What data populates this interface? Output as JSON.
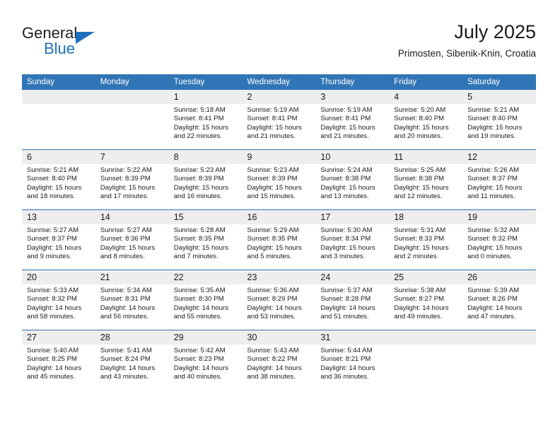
{
  "brand": {
    "name_part1": "General",
    "name_part2": "Blue"
  },
  "header": {
    "month_title": "July 2025",
    "location": "Primosten, Sibenik-Knin, Croatia"
  },
  "colors": {
    "header_blue": "#3075b5",
    "row_rule_blue": "#2e75b6",
    "daynum_bg": "#eeeeee",
    "brand_blue": "#1f6fba"
  },
  "weekday_headers": [
    "Sunday",
    "Monday",
    "Tuesday",
    "Wednesday",
    "Thursday",
    "Friday",
    "Saturday"
  ],
  "weeks": [
    [
      {
        "day": "",
        "sunrise": "",
        "sunset": "",
        "daylight_line1": "",
        "daylight_line2": ""
      },
      {
        "day": "",
        "sunrise": "",
        "sunset": "",
        "daylight_line1": "",
        "daylight_line2": ""
      },
      {
        "day": "1",
        "sunrise": "Sunrise: 5:18 AM",
        "sunset": "Sunset: 8:41 PM",
        "daylight_line1": "Daylight: 15 hours",
        "daylight_line2": "and 22 minutes."
      },
      {
        "day": "2",
        "sunrise": "Sunrise: 5:19 AM",
        "sunset": "Sunset: 8:41 PM",
        "daylight_line1": "Daylight: 15 hours",
        "daylight_line2": "and 21 minutes."
      },
      {
        "day": "3",
        "sunrise": "Sunrise: 5:19 AM",
        "sunset": "Sunset: 8:41 PM",
        "daylight_line1": "Daylight: 15 hours",
        "daylight_line2": "and 21 minutes."
      },
      {
        "day": "4",
        "sunrise": "Sunrise: 5:20 AM",
        "sunset": "Sunset: 8:40 PM",
        "daylight_line1": "Daylight: 15 hours",
        "daylight_line2": "and 20 minutes."
      },
      {
        "day": "5",
        "sunrise": "Sunrise: 5:21 AM",
        "sunset": "Sunset: 8:40 PM",
        "daylight_line1": "Daylight: 15 hours",
        "daylight_line2": "and 19 minutes."
      }
    ],
    [
      {
        "day": "6",
        "sunrise": "Sunrise: 5:21 AM",
        "sunset": "Sunset: 8:40 PM",
        "daylight_line1": "Daylight: 15 hours",
        "daylight_line2": "and 18 minutes."
      },
      {
        "day": "7",
        "sunrise": "Sunrise: 5:22 AM",
        "sunset": "Sunset: 8:39 PM",
        "daylight_line1": "Daylight: 15 hours",
        "daylight_line2": "and 17 minutes."
      },
      {
        "day": "8",
        "sunrise": "Sunrise: 5:23 AM",
        "sunset": "Sunset: 8:39 PM",
        "daylight_line1": "Daylight: 15 hours",
        "daylight_line2": "and 16 minutes."
      },
      {
        "day": "9",
        "sunrise": "Sunrise: 5:23 AM",
        "sunset": "Sunset: 8:39 PM",
        "daylight_line1": "Daylight: 15 hours",
        "daylight_line2": "and 15 minutes."
      },
      {
        "day": "10",
        "sunrise": "Sunrise: 5:24 AM",
        "sunset": "Sunset: 8:38 PM",
        "daylight_line1": "Daylight: 15 hours",
        "daylight_line2": "and 13 minutes."
      },
      {
        "day": "11",
        "sunrise": "Sunrise: 5:25 AM",
        "sunset": "Sunset: 8:38 PM",
        "daylight_line1": "Daylight: 15 hours",
        "daylight_line2": "and 12 minutes."
      },
      {
        "day": "12",
        "sunrise": "Sunrise: 5:26 AM",
        "sunset": "Sunset: 8:37 PM",
        "daylight_line1": "Daylight: 15 hours",
        "daylight_line2": "and 11 minutes."
      }
    ],
    [
      {
        "day": "13",
        "sunrise": "Sunrise: 5:27 AM",
        "sunset": "Sunset: 8:37 PM",
        "daylight_line1": "Daylight: 15 hours",
        "daylight_line2": "and 9 minutes."
      },
      {
        "day": "14",
        "sunrise": "Sunrise: 5:27 AM",
        "sunset": "Sunset: 8:36 PM",
        "daylight_line1": "Daylight: 15 hours",
        "daylight_line2": "and 8 minutes."
      },
      {
        "day": "15",
        "sunrise": "Sunrise: 5:28 AM",
        "sunset": "Sunset: 8:35 PM",
        "daylight_line1": "Daylight: 15 hours",
        "daylight_line2": "and 7 minutes."
      },
      {
        "day": "16",
        "sunrise": "Sunrise: 5:29 AM",
        "sunset": "Sunset: 8:35 PM",
        "daylight_line1": "Daylight: 15 hours",
        "daylight_line2": "and 5 minutes."
      },
      {
        "day": "17",
        "sunrise": "Sunrise: 5:30 AM",
        "sunset": "Sunset: 8:34 PM",
        "daylight_line1": "Daylight: 15 hours",
        "daylight_line2": "and 3 minutes."
      },
      {
        "day": "18",
        "sunrise": "Sunrise: 5:31 AM",
        "sunset": "Sunset: 8:33 PM",
        "daylight_line1": "Daylight: 15 hours",
        "daylight_line2": "and 2 minutes."
      },
      {
        "day": "19",
        "sunrise": "Sunrise: 5:32 AM",
        "sunset": "Sunset: 8:32 PM",
        "daylight_line1": "Daylight: 15 hours",
        "daylight_line2": "and 0 minutes."
      }
    ],
    [
      {
        "day": "20",
        "sunrise": "Sunrise: 5:33 AM",
        "sunset": "Sunset: 8:32 PM",
        "daylight_line1": "Daylight: 14 hours",
        "daylight_line2": "and 58 minutes."
      },
      {
        "day": "21",
        "sunrise": "Sunrise: 5:34 AM",
        "sunset": "Sunset: 8:31 PM",
        "daylight_line1": "Daylight: 14 hours",
        "daylight_line2": "and 56 minutes."
      },
      {
        "day": "22",
        "sunrise": "Sunrise: 5:35 AM",
        "sunset": "Sunset: 8:30 PM",
        "daylight_line1": "Daylight: 14 hours",
        "daylight_line2": "and 55 minutes."
      },
      {
        "day": "23",
        "sunrise": "Sunrise: 5:36 AM",
        "sunset": "Sunset: 8:29 PM",
        "daylight_line1": "Daylight: 14 hours",
        "daylight_line2": "and 53 minutes."
      },
      {
        "day": "24",
        "sunrise": "Sunrise: 5:37 AM",
        "sunset": "Sunset: 8:28 PM",
        "daylight_line1": "Daylight: 14 hours",
        "daylight_line2": "and 51 minutes."
      },
      {
        "day": "25",
        "sunrise": "Sunrise: 5:38 AM",
        "sunset": "Sunset: 8:27 PM",
        "daylight_line1": "Daylight: 14 hours",
        "daylight_line2": "and 49 minutes."
      },
      {
        "day": "26",
        "sunrise": "Sunrise: 5:39 AM",
        "sunset": "Sunset: 8:26 PM",
        "daylight_line1": "Daylight: 14 hours",
        "daylight_line2": "and 47 minutes."
      }
    ],
    [
      {
        "day": "27",
        "sunrise": "Sunrise: 5:40 AM",
        "sunset": "Sunset: 8:25 PM",
        "daylight_line1": "Daylight: 14 hours",
        "daylight_line2": "and 45 minutes."
      },
      {
        "day": "28",
        "sunrise": "Sunrise: 5:41 AM",
        "sunset": "Sunset: 8:24 PM",
        "daylight_line1": "Daylight: 14 hours",
        "daylight_line2": "and 43 minutes."
      },
      {
        "day": "29",
        "sunrise": "Sunrise: 5:42 AM",
        "sunset": "Sunset: 8:23 PM",
        "daylight_line1": "Daylight: 14 hours",
        "daylight_line2": "and 40 minutes."
      },
      {
        "day": "30",
        "sunrise": "Sunrise: 5:43 AM",
        "sunset": "Sunset: 8:22 PM",
        "daylight_line1": "Daylight: 14 hours",
        "daylight_line2": "and 38 minutes."
      },
      {
        "day": "31",
        "sunrise": "Sunrise: 5:44 AM",
        "sunset": "Sunset: 8:21 PM",
        "daylight_line1": "Daylight: 14 hours",
        "daylight_line2": "and 36 minutes."
      },
      {
        "day": "",
        "sunrise": "",
        "sunset": "",
        "daylight_line1": "",
        "daylight_line2": ""
      },
      {
        "day": "",
        "sunrise": "",
        "sunset": "",
        "daylight_line1": "",
        "daylight_line2": ""
      }
    ]
  ]
}
